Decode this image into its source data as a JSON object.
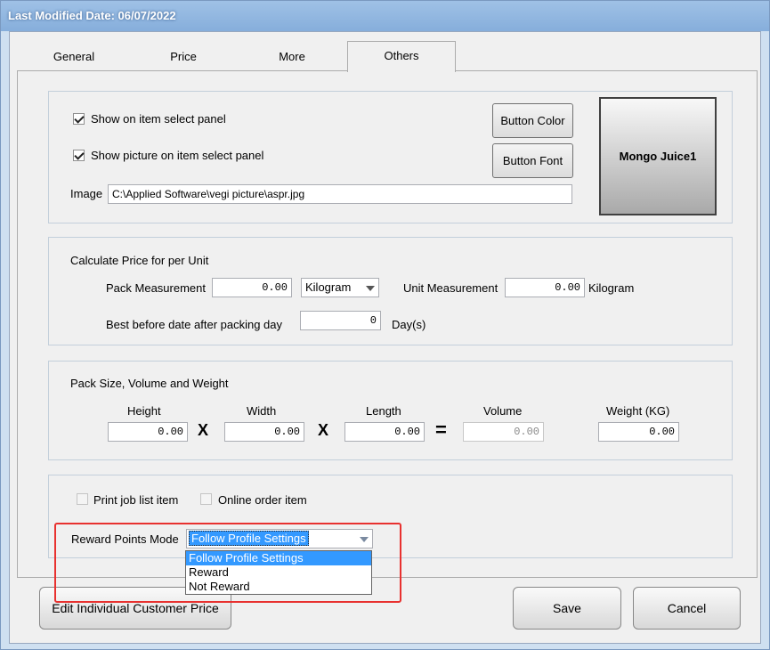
{
  "window": {
    "title": "Last Modified Date: 06/07/2022"
  },
  "tabs": [
    {
      "label": "General"
    },
    {
      "label": "Price"
    },
    {
      "label": "More"
    },
    {
      "label": "Others"
    }
  ],
  "display": {
    "show_item_label": "Show on item select panel",
    "show_item_checked": true,
    "show_picture_label": "Show picture on item select panel",
    "show_picture_checked": true,
    "image_label": "Image",
    "image_path": "C:\\Applied Software\\vegi picture\\aspr.jpg",
    "button_color_label": "Button Color",
    "button_font_label": "Button Font",
    "preview_label": "Mongo Juice1"
  },
  "unit_price": {
    "title": "Calculate Price for per Unit",
    "pack_measurement_label": "Pack Measurement",
    "pack_measurement_value": "0.00",
    "pack_unit": "Kilogram",
    "unit_measurement_label": "Unit Measurement",
    "unit_measurement_value": "0.00",
    "unit_measurement_unit": "Kilogram",
    "best_before_label": "Best before date after packing day",
    "best_before_value": "0",
    "best_before_unit": "Day(s)"
  },
  "pack_size": {
    "title": "Pack Size,  Volume and Weight",
    "height_label": "Height",
    "height_value": "0.00",
    "width_label": "Width",
    "width_value": "0.00",
    "length_label": "Length",
    "length_value": "0.00",
    "volume_label": "Volume",
    "volume_value": "0.00",
    "weight_label": "Weight (KG)",
    "weight_value": "0.00",
    "times_symbol": "X",
    "equals_symbol": "="
  },
  "misc": {
    "print_job_label": "Print job list item",
    "online_order_label": "Online order item",
    "reward_mode_label": "Reward Points Mode",
    "reward_mode_value": "Follow Profile Settings",
    "reward_options": [
      "Follow Profile Settings",
      "Reward",
      "Not Reward"
    ]
  },
  "footer": {
    "edit_price_label": "Edit Individual Customer Price",
    "save_label": "Save",
    "cancel_label": "Cancel"
  },
  "colors": {
    "selection": "#3399ff",
    "highlight": "#e8312f"
  }
}
